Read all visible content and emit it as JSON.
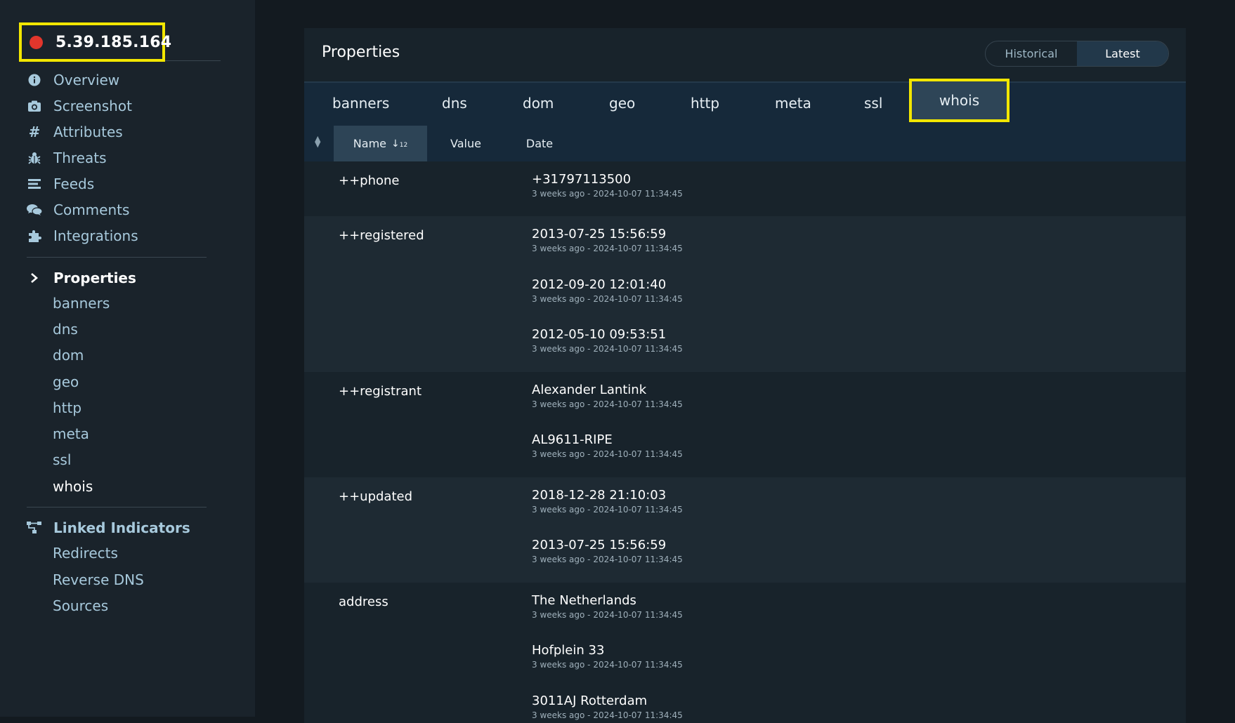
{
  "host": {
    "ip": "5.39.185.164",
    "status_color": "#e2362c"
  },
  "nav": [
    {
      "label": "Overview",
      "icon": "info-circle-icon"
    },
    {
      "label": "Screenshot",
      "icon": "camera-icon"
    },
    {
      "label": "Attributes",
      "icon": "hash-icon"
    },
    {
      "label": "Threats",
      "icon": "bug-icon"
    },
    {
      "label": "Feeds",
      "icon": "list-icon"
    },
    {
      "label": "Comments",
      "icon": "comments-icon"
    },
    {
      "label": "Integrations",
      "icon": "puzzle-icon"
    }
  ],
  "properties_section": {
    "title": "Properties",
    "items": [
      "banners",
      "dns",
      "dom",
      "geo",
      "http",
      "meta",
      "ssl",
      "whois"
    ],
    "active": "whois"
  },
  "linked_section": {
    "title": "Linked Indicators",
    "items": [
      "Redirects",
      "Reverse DNS",
      "Sources"
    ]
  },
  "panel": {
    "title": "Properties",
    "toggle": {
      "historical": "Historical",
      "latest": "Latest",
      "selected": "Latest"
    },
    "tabs": [
      "banners",
      "dns",
      "dom",
      "geo",
      "http",
      "meta",
      "ssl",
      "whois"
    ],
    "active_tab": "whois",
    "columns": {
      "name": "Name",
      "value": "Value",
      "date": "Date"
    }
  },
  "groups": [
    {
      "name": "++phone",
      "values": [
        {
          "value": "+31797113500",
          "date": "3 weeks ago - 2024-10-07 11:34:45"
        }
      ]
    },
    {
      "name": "++registered",
      "values": [
        {
          "value": "2013-07-25 15:56:59",
          "date": "3 weeks ago - 2024-10-07 11:34:45"
        },
        {
          "value": "2012-09-20 12:01:40",
          "date": "3 weeks ago - 2024-10-07 11:34:45"
        },
        {
          "value": "2012-05-10 09:53:51",
          "date": "3 weeks ago - 2024-10-07 11:34:45"
        }
      ]
    },
    {
      "name": "++registrant",
      "values": [
        {
          "value": "Alexander Lantink",
          "date": "3 weeks ago - 2024-10-07 11:34:45"
        },
        {
          "value": "AL9611-RIPE",
          "date": "3 weeks ago - 2024-10-07 11:34:45"
        }
      ]
    },
    {
      "name": "++updated",
      "values": [
        {
          "value": "2018-12-28 21:10:03",
          "date": "3 weeks ago - 2024-10-07 11:34:45"
        },
        {
          "value": "2013-07-25 15:56:59",
          "date": "3 weeks ago - 2024-10-07 11:34:45"
        }
      ]
    },
    {
      "name": "address",
      "values": [
        {
          "value": "The Netherlands",
          "date": "3 weeks ago - 2024-10-07 11:34:45"
        },
        {
          "value": "Hofplein 33",
          "date": "3 weeks ago - 2024-10-07 11:34:45"
        },
        {
          "value": "3011AJ Rotterdam",
          "date": "3 weeks ago - 2024-10-07 11:34:45"
        }
      ]
    }
  ]
}
